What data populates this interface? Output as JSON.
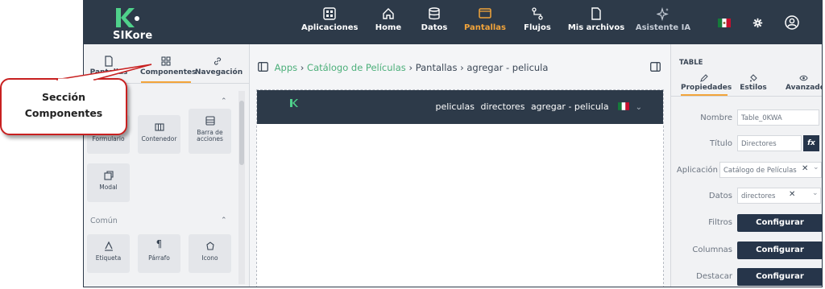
{
  "app": {
    "name": "SIKore"
  },
  "nav": [
    {
      "label": "Aplicaciones",
      "icon": "apps-grid-icon"
    },
    {
      "label": "Home",
      "icon": "home-icon"
    },
    {
      "label": "Datos",
      "icon": "database-icon"
    },
    {
      "label": "Pantallas",
      "icon": "screen-icon",
      "active": true
    },
    {
      "label": "Flujos",
      "icon": "flow-icon"
    },
    {
      "label": "Mis archivos",
      "icon": "file-icon"
    },
    {
      "label": "Asistente IA",
      "icon": "sparkle-icon"
    }
  ],
  "left_tabs": [
    {
      "label": "Pantallas"
    },
    {
      "label": "Componentes",
      "active": true
    },
    {
      "label": "Navegación"
    }
  ],
  "sections": {
    "comun_label": "Común"
  },
  "components": [
    {
      "label": "Formulario"
    },
    {
      "label": "Contenedor"
    },
    {
      "label": "Barra de acciones"
    },
    {
      "label": "Modal"
    }
  ],
  "common_components": [
    {
      "label": "Etiqueta"
    },
    {
      "label": "Párrafo"
    },
    {
      "label": "Icono"
    }
  ],
  "callout": {
    "line1": "Sección",
    "line2": "Componentes"
  },
  "breadcrumb": {
    "apps": "Apps",
    "app": "Catálogo de Películas",
    "section": "Pantallas",
    "screen": "agregar - pelicula"
  },
  "preview": {
    "links": [
      "peliculas",
      "directores",
      "agregar - pelicula"
    ]
  },
  "properties": {
    "title": "TABLE",
    "tabs": [
      {
        "label": "Propiedades",
        "active": true
      },
      {
        "label": "Estilos"
      },
      {
        "label": "Avanzado"
      }
    ],
    "nombre_label": "Nombre",
    "nombre_value": "Table_0KWA",
    "titulo_label": "Título",
    "titulo_value": "Directores",
    "aplicacion_label": "Aplicación",
    "aplicacion_value": "Catálogo de Películas",
    "datos_label": "Datos",
    "datos_value": "directores",
    "filtros_label": "Filtros",
    "columnas_label": "Columnas",
    "destacar_label": "Destacar",
    "configurar_label": "Configurar",
    "fx_label": "fx"
  },
  "colors": {
    "topbar": "#2d3a49",
    "accent": "#f2a43a",
    "link": "#4caf7a",
    "callout_border": "#c82020",
    "button": "#26354a"
  }
}
